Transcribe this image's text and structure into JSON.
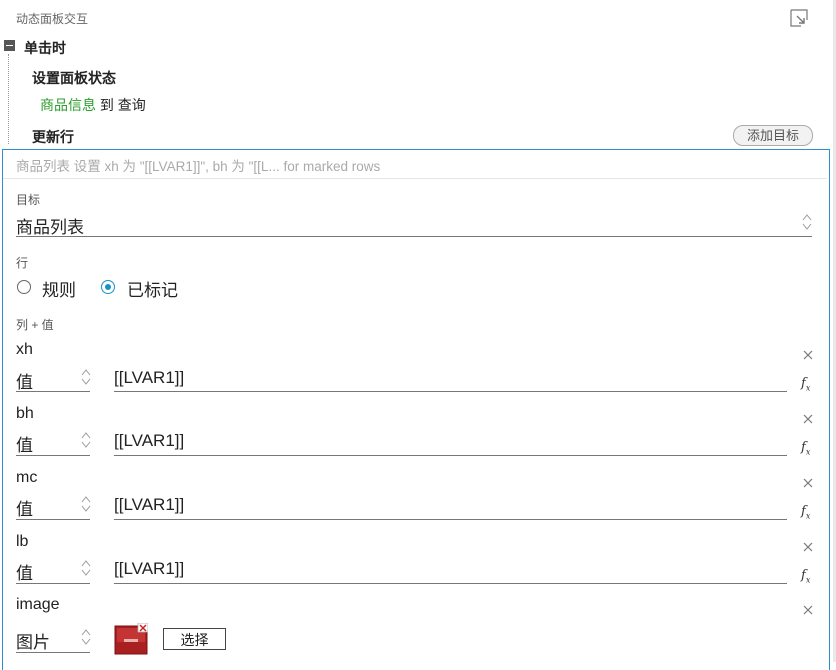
{
  "section": {
    "title": "动态面板交互"
  },
  "event": {
    "label": "单击时"
  },
  "actions": [
    {
      "label": "设置面板状态",
      "panel": "商品信息",
      "connector": "到",
      "state": "查询"
    },
    {
      "label": "更新行"
    }
  ],
  "add_target_label": "添加目标",
  "summary": "商品列表 设置 xh 为 \"[[LVAR1]]\", bh 为 \"[[L... for marked rows",
  "target": {
    "label": "目标",
    "value": "商品列表"
  },
  "rows": {
    "label": "行",
    "options": [
      {
        "label": "规则",
        "checked": false
      },
      {
        "label": "已标记",
        "checked": true
      }
    ]
  },
  "columns_label": "列 + 值",
  "columns": [
    {
      "name": "xh",
      "type": "值",
      "value": "[[LVAR1]]"
    },
    {
      "name": "bh",
      "type": "值",
      "value": "[[LVAR1]]"
    },
    {
      "name": "mc",
      "type": "值",
      "value": "[[LVAR1]]"
    },
    {
      "name": "lb",
      "type": "值",
      "value": "[[LVAR1]]"
    }
  ],
  "image_column": {
    "name": "image",
    "type": "图片",
    "choose_label": "选择"
  },
  "icons": {
    "pin": "pin-icon",
    "collapse": "collapse-icon",
    "updown": "updown-icon",
    "close": "close-icon",
    "fx": "function-icon",
    "thumbnail": "image-thumbnail"
  },
  "colors": {
    "accent": "#2f8fce",
    "radio": "#1592c9",
    "link_green": "#2a9d2a"
  }
}
